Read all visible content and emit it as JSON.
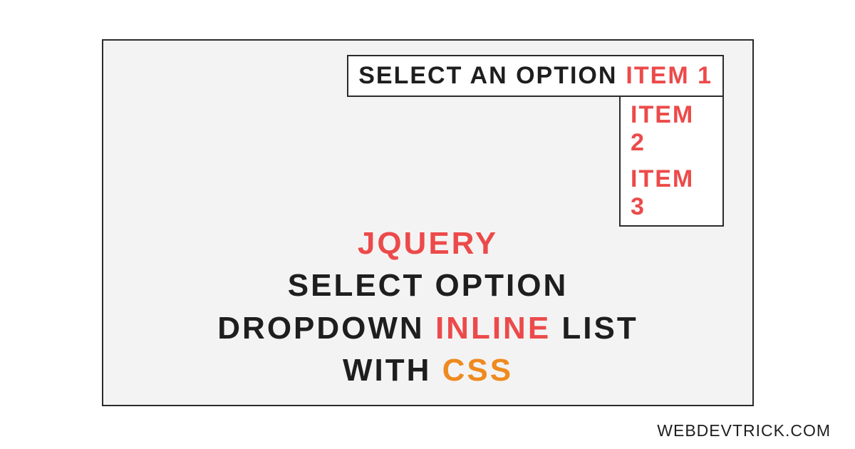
{
  "dropdown": {
    "label": "SELECT AN OPTION",
    "selected": "ITEM 1",
    "options": [
      "ITEM 2",
      "ITEM 3"
    ]
  },
  "title": {
    "word1": "JQUERY",
    "word2": "SELECT OPTION",
    "word3": "DROPDOWN",
    "word4": "INLINE",
    "word5": "LIST",
    "word6": "WITH",
    "word7": "CSS"
  },
  "watermark": "WEBDEVTRICK.COM"
}
